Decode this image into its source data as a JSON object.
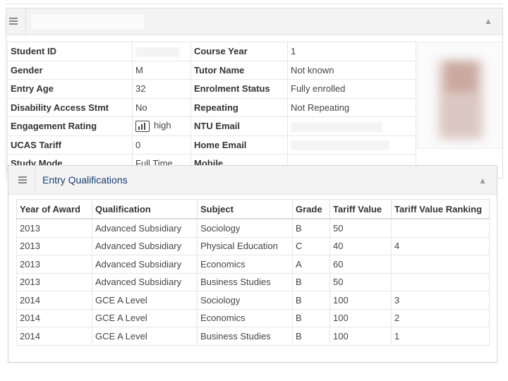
{
  "student_panel": {
    "rows": [
      {
        "l1": "Student ID",
        "v1": "",
        "l2": "Course Year",
        "v2": "1"
      },
      {
        "l1": "Gender",
        "v1": "M",
        "l2": "Tutor Name",
        "v2": "Not known"
      },
      {
        "l1": "Entry Age",
        "v1": "32",
        "l2": "Enrolment Status",
        "v2": "Fully enrolled"
      },
      {
        "l1": "Disability Access Stmt",
        "v1": "No",
        "l2": "Repeating",
        "v2": "Not Repeating"
      },
      {
        "l1": "Engagement Rating",
        "v1": "high",
        "l2": "NTU Email",
        "v2": ""
      },
      {
        "l1": "UCAS Tariff",
        "v1": "0",
        "l2": "Home Email",
        "v2": ""
      },
      {
        "l1": "Study Mode",
        "v1": "Full Time",
        "l2": "Mobile",
        "v2": ""
      }
    ]
  },
  "qualifications": {
    "title": "Entry Qualifications",
    "columns": [
      "Year of Award",
      "Qualification",
      "Subject",
      "Grade",
      "Tariff Value",
      "Tariff Value Ranking"
    ],
    "rows": [
      [
        "2013",
        "Advanced Subsidiary",
        "Sociology",
        "B",
        "50",
        ""
      ],
      [
        "2013",
        "Advanced Subsidiary",
        "Physical Education",
        "C",
        "40",
        "4"
      ],
      [
        "2013",
        "Advanced Subsidiary",
        "Economics",
        "A",
        "60",
        ""
      ],
      [
        "2013",
        "Advanced Subsidiary",
        "Business Studies",
        "B",
        "50",
        ""
      ],
      [
        "2014",
        "GCE A Level",
        "Sociology",
        "B",
        "100",
        "3"
      ],
      [
        "2014",
        "GCE A Level",
        "Economics",
        "B",
        "100",
        "2"
      ],
      [
        "2014",
        "GCE A Level",
        "Business Studies",
        "B",
        "100",
        "1"
      ]
    ]
  },
  "icons": {
    "menu": "hamburger-menu-icon",
    "collapse": "chevron-up-icon",
    "engagement": "bar-chart-icon"
  }
}
